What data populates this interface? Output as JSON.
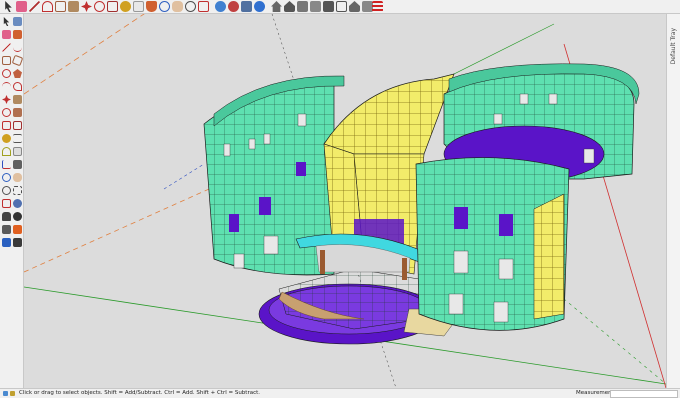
{
  "status": {
    "hint": "Click or drag to select objects. Shift = Add/Subtract. Ctrl = Add. Shift + Ctrl = Subtract.",
    "measurements_label": "Measurements",
    "measurements_value": ""
  },
  "tray": {
    "title": "Default Tray"
  },
  "top_toolbar": {
    "icons": [
      "select-icon",
      "eraser-icon",
      "line-icon",
      "arc-icon",
      "rectangle-icon",
      "push-pull-icon",
      "move-icon",
      "rotate-icon",
      "offset-icon",
      "tape-measure-icon",
      "text-icon",
      "paint-bucket-icon",
      "orbit-icon",
      "pan-icon",
      "zoom-icon",
      "zoom-extents-icon",
      "warehouse-icon",
      "extension-icon",
      "components-icon",
      "model-info-icon",
      "home-icon",
      "house-icon",
      "iso-view-icon",
      "menu-icon"
    ]
  },
  "left_toolbar": {
    "icons": [
      "select-icon",
      "make-component-icon",
      "eraser-icon",
      "paint-bucket-icon",
      "line-icon",
      "freehand-icon",
      "rectangle-icon",
      "rotated-rectangle-icon",
      "circle-icon",
      "polygon-icon",
      "arc-icon",
      "pie-icon",
      "move-icon",
      "push-pull-icon",
      "rotate-icon",
      "follow-me-icon",
      "scale-icon",
      "offset-icon",
      "tape-measure-icon",
      "dimension-icon",
      "protractor-icon",
      "text-icon",
      "axes-icon",
      "3d-text-icon",
      "orbit-icon",
      "pan-icon",
      "zoom-icon",
      "zoom-window-icon",
      "zoom-extents-icon",
      "previous-view-icon",
      "walk-icon",
      "look-around-icon",
      "position-camera-icon",
      "section-plane-icon",
      "display-section-icon",
      "section-cuts-icon"
    ]
  },
  "colors": {
    "building_fill": "#5ee0b0",
    "roof_glass": "#f2ec6a",
    "floor_purple": "#5a14c8",
    "canopy": "#40d8e0",
    "background": "#dcdcdc"
  }
}
